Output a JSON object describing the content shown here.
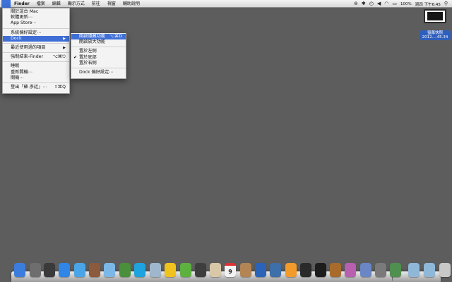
{
  "menubar": {
    "apple_symbol": "",
    "app_name": "Finder",
    "menus": [
      "檔案",
      "編輯",
      "顯示方式",
      "前往",
      "視窗",
      "輔助說明"
    ],
    "battery": "100%",
    "clock": "週四 下午6:45",
    "status_icons": [
      "headphone-icon",
      "bluetooth-icon",
      "timemachine-icon",
      "wifi-icon",
      "volume-icon",
      "search-icon"
    ]
  },
  "apple_menu": {
    "items": [
      {
        "label": "關於這台 Mac"
      },
      {
        "label": "軟體更新⋯"
      },
      {
        "label": "App Store⋯"
      },
      {
        "label": "系統偏好設定⋯"
      },
      {
        "label": "Dock"
      },
      {
        "label": "最近使用過的項目"
      },
      {
        "label": "強制結束-Finder",
        "shortcut": "⌥⌘⎋"
      },
      {
        "label": "睡眠"
      },
      {
        "label": "重新開機⋯"
      },
      {
        "label": "關機⋯"
      },
      {
        "label": "登出「蘇 彥廷」⋯",
        "shortcut": "⇧⌘Q"
      }
    ]
  },
  "dock_submenu": {
    "items": [
      {
        "label": "開啟隱藏功能",
        "shortcut": "⌥⌘D"
      },
      {
        "label": "開啟放大功能"
      },
      {
        "label": "置於左側"
      },
      {
        "label": "置於底部"
      },
      {
        "label": "置於右側"
      },
      {
        "label": "Dock 偏好設定⋯"
      }
    ]
  },
  "desktop": {
    "icon_label": "螢幕快照\n2012....45.34"
  },
  "dock": {
    "calendar_day": "9",
    "apps": [
      {
        "name": "finder-icon",
        "color": "#3b7ddd"
      },
      {
        "name": "launchpad-icon",
        "color": "#6e6e6e"
      },
      {
        "name": "mission-control-icon",
        "color": "#3a3a3a"
      },
      {
        "name": "app-store-icon",
        "color": "#2f86e6"
      },
      {
        "name": "safari-icon",
        "color": "#4aa5e8"
      },
      {
        "name": "photo-booth-icon",
        "color": "#8c5a3c"
      },
      {
        "name": "itunes-icon",
        "color": "#7bb8e8"
      },
      {
        "name": "alien-app-icon",
        "color": "#4a8f3b"
      },
      {
        "name": "skype-icon",
        "color": "#1fa2e0"
      },
      {
        "name": "preview-icon",
        "color": "#9fb7cc"
      },
      {
        "name": "duck-app-icon",
        "color": "#f0c21e"
      },
      {
        "name": "utorrent-icon",
        "color": "#5db13e"
      },
      {
        "name": "evernote-icon",
        "color": "#3e3e3e"
      },
      {
        "name": "textedit-icon",
        "color": "#d9c8a8"
      },
      {
        "name": "calendar-icon",
        "color": "#f2f2f2"
      },
      {
        "name": "address-book-icon",
        "color": "#b38454"
      },
      {
        "name": "quicktime-icon",
        "color": "#2b63b8"
      },
      {
        "name": "screen-icon",
        "color": "#3d6fa8"
      },
      {
        "name": "smiley-app-icon",
        "color": "#f29b2b"
      },
      {
        "name": "image-viewer-icon",
        "color": "#2a2a2a"
      },
      {
        "name": "terminal-icon",
        "color": "#1d1d1d"
      },
      {
        "name": "photos-app-icon",
        "color": "#a86b2b"
      },
      {
        "name": "dashboard-icon",
        "color": "#b85fb0"
      },
      {
        "name": "xcode-icon",
        "color": "#6a86c4"
      },
      {
        "name": "system-preferences-icon",
        "color": "#7a7a7a"
      },
      {
        "name": "activity-icon",
        "color": "#4f8f4f"
      },
      {
        "name": "applications-folder-icon",
        "color": "#8fb8d8"
      },
      {
        "name": "downloads-folder-icon",
        "color": "#8fb8d8"
      },
      {
        "name": "trash-icon",
        "color": "#c8c8c8"
      }
    ]
  }
}
